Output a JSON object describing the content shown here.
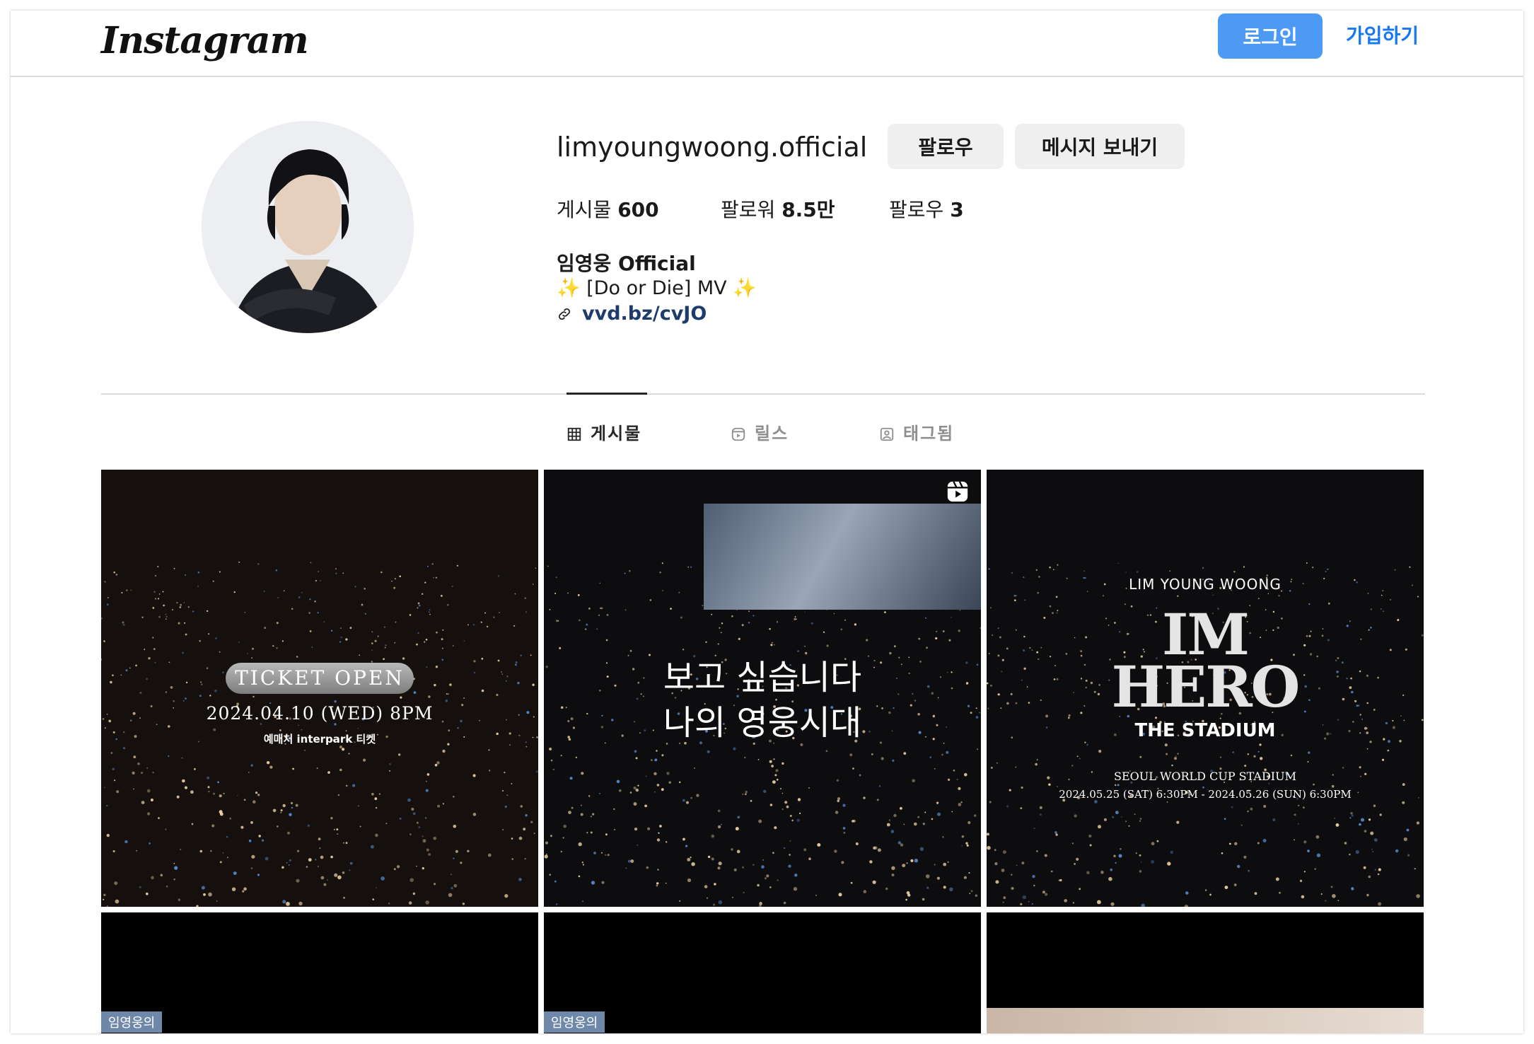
{
  "header": {
    "logo": "Instagram",
    "login_label": "로그인",
    "signup_label": "가입하기"
  },
  "profile": {
    "username": "limyoungwoong.official",
    "follow_label": "팔로우",
    "message_label": "메시지 보내기",
    "stats": {
      "posts_label": "게시물",
      "posts_value": "600",
      "followers_label": "팔로워",
      "followers_value": "8.5만",
      "following_label": "팔로우",
      "following_value": "3"
    },
    "full_name": "임영웅 Official",
    "bio_spark": "✨",
    "bio_text": "[Do or Die] MV",
    "link": "vvd.bz/cvJO"
  },
  "tabs": [
    {
      "label": "게시물",
      "active": true
    },
    {
      "label": "릴스",
      "active": false
    },
    {
      "label": "태그됨",
      "active": false
    }
  ],
  "posts": [
    {
      "badge": "TICKET OPEN",
      "date": "2024.04.10 (WED) 8PM",
      "seller": "예매처  interpark 티켓"
    },
    {
      "line1": "보고 싶습니다",
      "line2": "나의 영웅시대",
      "is_reel": true
    },
    {
      "artist": "LIM YOUNG WOONG",
      "title_line1": "IM",
      "title_line2": "HERO",
      "subtitle": "THE STADIUM",
      "venue": "SEOUL WORLD CUP STADIUM",
      "dates": "2024.05.25 (SAT) 6:30PM - 2024.05.26 (SUN) 6:30PM"
    },
    {
      "label": "임영웅의"
    },
    {
      "label": "임영웅의"
    },
    {}
  ],
  "colors": {
    "primary_button": "#4c9af4",
    "link": "#1877f2",
    "secondary_button": "#efefef",
    "divider": "#dbdbdb"
  }
}
